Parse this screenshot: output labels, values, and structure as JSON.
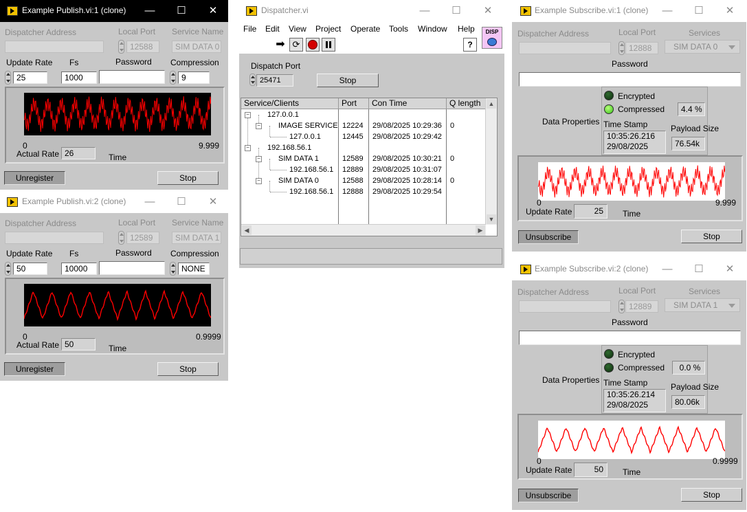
{
  "pub1": {
    "title": "Example Publish.vi:1 (clone)",
    "dispatcher_label": "Dispatcher Address",
    "local_port_label": "Local Port",
    "local_port": "12588",
    "service_label": "Service Name",
    "service": "SIM DATA 0",
    "update_label": "Update Rate",
    "update_rate": "25",
    "fs_label": "Fs",
    "fs": "1000",
    "password_label": "Password",
    "compression_label": "Compression",
    "compression": "9",
    "x_min": "0",
    "x_max": "9.999",
    "actual_label": "Actual Rate",
    "actual_rate": "26",
    "time_label": "Time",
    "unregister": "Unregister",
    "stop": "Stop"
  },
  "pub2": {
    "title": "Example Publish.vi:2 (clone)",
    "dispatcher_label": "Dispatcher Address",
    "local_port_label": "Local Port",
    "local_port": "12589",
    "service_label": "Service Name",
    "service": "SIM DATA 1",
    "update_label": "Update Rate",
    "update_rate": "50",
    "fs_label": "Fs",
    "fs": "10000",
    "password_label": "Password",
    "compression_label": "Compression",
    "compression": "NONE",
    "x_min": "0",
    "x_max": "0.9999",
    "actual_label": "Actual Rate",
    "actual_rate": "50",
    "time_label": "Time",
    "unregister": "Unregister",
    "stop": "Stop"
  },
  "dispatcher": {
    "title": "Dispatcher.vi",
    "menu": [
      "File",
      "Edit",
      "View",
      "Project",
      "Operate",
      "Tools",
      "Window",
      "Help"
    ],
    "disp_badge": "DISP",
    "help_glyph": "?",
    "port_label": "Dispatch Port",
    "port": "25471",
    "stop": "Stop",
    "columns": [
      "Service/Clients",
      "Port",
      "Con Time",
      "Q length"
    ],
    "rows": [
      {
        "name": "127.0.0.1",
        "port": "",
        "time": "",
        "q": ""
      },
      {
        "name": "IMAGE SERVICE",
        "port": "12224",
        "time": "29/08/2025 10:29:36",
        "q": "0"
      },
      {
        "name": "127.0.0.1",
        "port": "12445",
        "time": "29/08/2025 10:29:42",
        "q": ""
      },
      {
        "name": "192.168.56.1",
        "port": "",
        "time": "",
        "q": ""
      },
      {
        "name": "SIM DATA 1",
        "port": "12589",
        "time": "29/08/2025 10:30:21",
        "q": "0"
      },
      {
        "name": "192.168.56.1",
        "port": "12889",
        "time": "29/08/2025 10:31:07",
        "q": ""
      },
      {
        "name": "SIM DATA 0",
        "port": "12588",
        "time": "29/08/2025 10:28:14",
        "q": "0"
      },
      {
        "name": "192.168.56.1",
        "port": "12888",
        "time": "29/08/2025 10:29:54",
        "q": ""
      }
    ]
  },
  "sub1": {
    "title": "Example Subscribe.vi:1 (clone)",
    "dispatcher_label": "Dispatcher Address",
    "local_port_label": "Local Port",
    "local_port": "12888",
    "services_label": "Services",
    "service": "SIM DATA 0",
    "password_label": "Password",
    "encrypted_label": "Encrypted",
    "compressed_label": "Compressed",
    "compression_pct": "4.4 %",
    "data_props_label": "Data Properties",
    "timestamp_label": "Time Stamp",
    "timestamp_time": "10:35:26.216",
    "timestamp_date": "29/08/2025",
    "payload_label": "Payload Size",
    "payload": "76.54k",
    "x_min": "0",
    "x_max": "9.999",
    "update_label": "Update Rate",
    "update_rate": "25",
    "time_label": "Time",
    "unsubscribe": "Unsubscribe",
    "stop": "Stop"
  },
  "sub2": {
    "title": "Example Subscribe.vi:2 (clone)",
    "dispatcher_label": "Dispatcher Address",
    "local_port_label": "Local Port",
    "local_port": "12889",
    "services_label": "Services",
    "service": "SIM DATA 1",
    "password_label": "Password",
    "encrypted_label": "Encrypted",
    "compressed_label": "Compressed",
    "compression_pct": "0.0 %",
    "data_props_label": "Data Properties",
    "timestamp_label": "Time Stamp",
    "timestamp_time": "10:35:26.214",
    "timestamp_date": "29/08/2025",
    "payload_label": "Payload Size",
    "payload": "80.06k",
    "x_min": "0",
    "x_max": "0.9999",
    "update_label": "Update Rate",
    "update_rate": "50",
    "time_label": "Time",
    "unsubscribe": "Unsubscribe",
    "stop": "Stop"
  },
  "titlebar_buttons": {
    "minimize": "—",
    "maximize": "☐",
    "close": "✕"
  },
  "colors": {
    "signal": "#ff0000",
    "plot_bg": "#000000",
    "plot_bg_light": "#ffffff"
  }
}
